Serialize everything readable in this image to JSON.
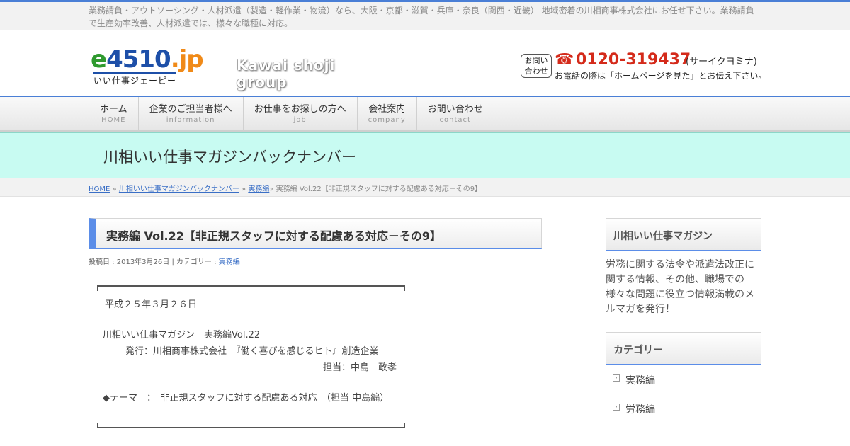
{
  "topbar": {
    "text": "業務請負・アウトソーシング・人材派遣（製造・軽作業・物流）なら、大阪・京都・滋賀・兵庫・奈良（関西・近畿） 地域密着の川相商事株式会社にお任せ下さい。業務請負で生産効率改善、人材派遣では、様々な職種に対応。"
  },
  "logo": {
    "e": "e",
    "num": "4510",
    "jp": ".jp",
    "sub": "いい仕事ジェーピー",
    "group": "Kawai shoji group"
  },
  "contact": {
    "box": "お問い\n合わせ",
    "box_line1": "お問い",
    "box_line2": "合わせ",
    "phone": "0120-319437",
    "kana": "(サーイクヨミナ)",
    "note": "お電話の際は「ホームページを見た」とお伝え下さい。",
    "icon": "phone-icon"
  },
  "nav": [
    {
      "jp": "ホーム",
      "en": "HOME"
    },
    {
      "jp": "企業のご担当者様へ",
      "en": "information"
    },
    {
      "jp": "お仕事をお探しの方へ",
      "en": "job"
    },
    {
      "jp": "会社案内",
      "en": "company"
    },
    {
      "jp": "お問い合わせ",
      "en": "contact"
    }
  ],
  "banner": {
    "title": "川相いい仕事マガジンバックナンバー"
  },
  "breadcrumb": {
    "home": "HOME",
    "sep": "»",
    "backnumber": "川相いい仕事マガジンバックナンバー",
    "category": "実務編",
    "current": "実務編 Vol.22【非正規スタッフに対する配慮ある対応－その9】"
  },
  "post": {
    "title": "実務編 Vol.22【非正規スタッフに対する配慮ある対応－その9】",
    "meta_prefix": "投稿日 : 2013年3月26日 | カテゴリー : ",
    "meta_category": "実務編",
    "date": "平成２５年３月２６日",
    "magazine": "川相いい仕事マガジン　実務編Vol.22",
    "publisher": "発行：川相商事株式会社　『働く喜びを感じるヒト』創造企業",
    "author": "担当：中島　政孝",
    "theme": "◆テーマ　：　非正規スタッフに対する配慮ある対応　（担当 中島編）"
  },
  "sidebar": {
    "magazine_title": "川相いい仕事マガジン",
    "magazine_desc": "労務に関する法令や派遣法改正に関する情報、その他、職場での様々な問題に役立つ情報満載のメルマガを発行！",
    "category_title": "カテゴリー",
    "categories": [
      "実務編",
      "労務編"
    ]
  },
  "colors": {
    "accent": "#5b8de8",
    "banner_bg": "#c8fbf2",
    "phone": "#d42a1a"
  }
}
